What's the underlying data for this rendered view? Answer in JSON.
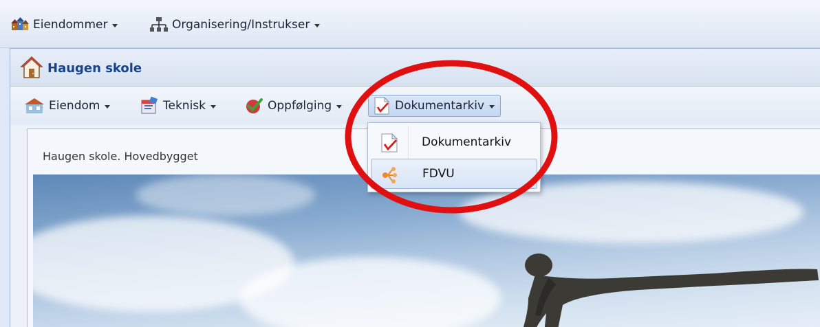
{
  "toolbar": {
    "items": [
      {
        "label": "Eiendommer",
        "icon": "buildings-icon"
      },
      {
        "label": "Organisering/Instrukser",
        "icon": "org-chart-icon"
      }
    ]
  },
  "panel": {
    "title": "Haugen skole",
    "icon": "house-icon"
  },
  "subtoolbar": {
    "items": [
      {
        "label": "Eiendom",
        "icon": "property-icon"
      },
      {
        "label": "Teknisk",
        "icon": "technical-icon"
      },
      {
        "label": "Oppfølging",
        "icon": "followup-check-icon"
      },
      {
        "label": "Dokumentarkiv",
        "icon": "document-icon"
      }
    ]
  },
  "content": {
    "title": "Haugen skole. Hovedbygget"
  },
  "dropdown": {
    "items": [
      {
        "label": "Dokumentarkiv",
        "icon": "document-icon"
      },
      {
        "label": "FDVU",
        "icon": "fdvu-tree-icon"
      }
    ]
  },
  "colors": {
    "accent": "#15428b",
    "annotation": "#e01010"
  }
}
